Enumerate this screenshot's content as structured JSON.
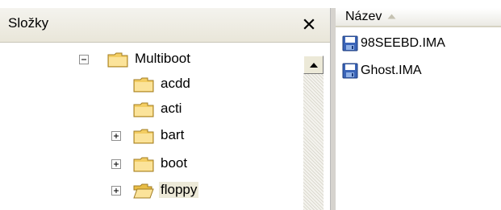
{
  "folders_pane": {
    "title": "Složky",
    "tree": [
      {
        "label": "Multiboot",
        "expander": "minus",
        "state": "closed"
      },
      {
        "label": "acdd",
        "expander": "none",
        "state": "closed"
      },
      {
        "label": "acti",
        "expander": "none",
        "state": "closed"
      },
      {
        "label": "bart",
        "expander": "plus",
        "state": "closed"
      },
      {
        "label": "boot",
        "expander": "plus",
        "state": "closed"
      },
      {
        "label": "floppy",
        "expander": "plus",
        "state": "open",
        "selected": true
      }
    ]
  },
  "files_pane": {
    "column_header": "Název",
    "sort_direction": "ascending",
    "files": [
      {
        "name": "98SEEBD.IMA",
        "icon": "floppy-disk-icon"
      },
      {
        "name": "Ghost.IMA",
        "icon": "floppy-disk-icon"
      }
    ]
  },
  "colors": {
    "folder_yellow": "#f6d36b",
    "selection": "#ece9d8",
    "header_bg": "#ece9d8"
  }
}
